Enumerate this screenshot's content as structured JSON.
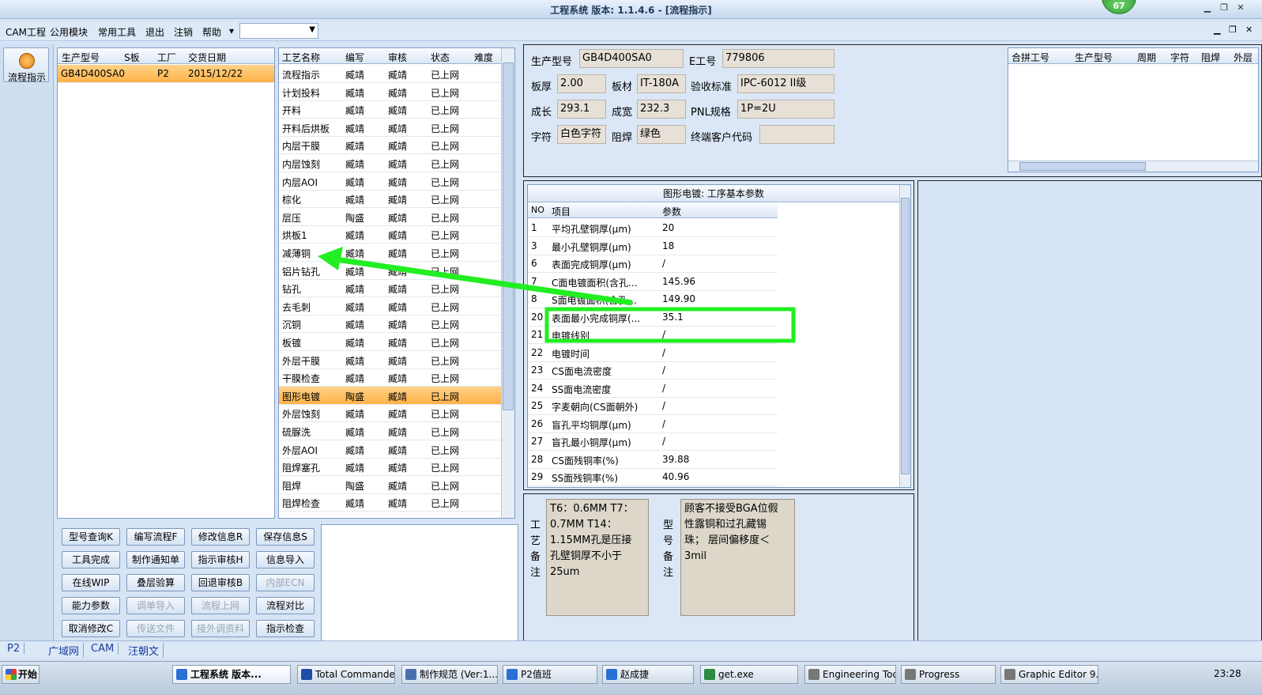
{
  "window": {
    "title": "工程系统  版本: 1.1.4.6 - [流程指示]",
    "badge": "67"
  },
  "menu": {
    "items": [
      "CAM工程",
      "公用模块",
      "常用工具",
      "退出",
      "注销",
      "帮助"
    ],
    "dropdown_arrow": "▾",
    "combo_value": ""
  },
  "leftstrip": {
    "flow_button": "流程指示"
  },
  "model_grid": {
    "headers": [
      "生产型号",
      "S板",
      "工厂",
      "交货日期"
    ],
    "rows": [
      [
        "GB4D400SA0",
        "",
        "P2",
        "2015/12/22"
      ]
    ]
  },
  "process_grid": {
    "headers": [
      "工艺名称",
      "编写",
      "审核",
      "状态",
      "难度"
    ],
    "rows": [
      [
        "流程指示",
        "臧靖",
        "臧靖",
        "已上网"
      ],
      [
        "计划投料",
        "臧靖",
        "臧靖",
        "已上网"
      ],
      [
        "开料",
        "臧靖",
        "臧靖",
        "已上网"
      ],
      [
        "开料后烘板",
        "臧靖",
        "臧靖",
        "已上网"
      ],
      [
        "内层干膜",
        "臧靖",
        "臧靖",
        "已上网"
      ],
      [
        "内层蚀刻",
        "臧靖",
        "臧靖",
        "已上网"
      ],
      [
        "内层AOI",
        "臧靖",
        "臧靖",
        "已上网"
      ],
      [
        "棕化",
        "臧靖",
        "臧靖",
        "已上网"
      ],
      [
        "层压",
        "陶盛",
        "臧靖",
        "已上网"
      ],
      [
        "烘板1",
        "臧靖",
        "臧靖",
        "已上网"
      ],
      [
        "减薄铜",
        "臧靖",
        "臧靖",
        "已上网"
      ],
      [
        "铝片钻孔",
        "臧靖",
        "臧靖",
        "已上网"
      ],
      [
        "钻孔",
        "臧靖",
        "臧靖",
        "已上网"
      ],
      [
        "去毛刺",
        "臧靖",
        "臧靖",
        "已上网"
      ],
      [
        "沉铜",
        "臧靖",
        "臧靖",
        "已上网"
      ],
      [
        "板镀",
        "臧靖",
        "臧靖",
        "已上网"
      ],
      [
        "外层干膜",
        "臧靖",
        "臧靖",
        "已上网"
      ],
      [
        "干膜检查",
        "臧靖",
        "臧靖",
        "已上网"
      ],
      [
        "图形电镀",
        "陶盛",
        "臧靖",
        "已上网"
      ],
      [
        "外层蚀刻",
        "臧靖",
        "臧靖",
        "已上网"
      ],
      [
        "硫脲洗",
        "臧靖",
        "臧靖",
        "已上网"
      ],
      [
        "外层AOI",
        "臧靖",
        "臧靖",
        "已上网"
      ],
      [
        "阻焊塞孔",
        "臧靖",
        "臧靖",
        "已上网"
      ],
      [
        "阻焊",
        "陶盛",
        "臧靖",
        "已上网"
      ],
      [
        "阻焊检查",
        "臧靖",
        "臧靖",
        "已上网"
      ]
    ],
    "selected_index": 18
  },
  "buttons": [
    {
      "label": "型号查询K",
      "enabled": true
    },
    {
      "label": "编写流程F",
      "enabled": true
    },
    {
      "label": "修改信息R",
      "enabled": true
    },
    {
      "label": "保存信息S",
      "enabled": true
    },
    {
      "label": "工具完成",
      "enabled": true
    },
    {
      "label": "制作通知单",
      "enabled": true
    },
    {
      "label": "指示审核H",
      "enabled": true
    },
    {
      "label": "信息导入",
      "enabled": true
    },
    {
      "label": "在线WIP",
      "enabled": true
    },
    {
      "label": "叠层验算",
      "enabled": true
    },
    {
      "label": "回退审核B",
      "enabled": true
    },
    {
      "label": "内部ECN",
      "enabled": false
    },
    {
      "label": "能力参数",
      "enabled": true
    },
    {
      "label": "调单导入",
      "enabled": false
    },
    {
      "label": "流程上网",
      "enabled": false
    },
    {
      "label": "流程对比",
      "enabled": true
    },
    {
      "label": "取消修改C",
      "enabled": true
    },
    {
      "label": "传送文件",
      "enabled": false
    },
    {
      "label": "接外调资料",
      "enabled": false
    },
    {
      "label": "指示检查",
      "enabled": true
    }
  ],
  "info": {
    "model_label": "生产型号",
    "model": "GB4D400SA0",
    "e_label": "E工号",
    "e_no": "779806",
    "thickness_label": "板厚",
    "thickness": "2.00",
    "material_label": "板材",
    "material": "IT-180A",
    "standard_label": "验收标准",
    "standard": "IPC-6012 II级",
    "length_label": "成长",
    "length": "293.1",
    "width_label": "成宽",
    "width": "232.3",
    "pnl_label": "PNL规格",
    "pnl": "1P=2U",
    "char_label": "字符",
    "char": "白色字符",
    "mask_label": "阻焊",
    "mask": "绿色",
    "customer_label": "终端客户代码",
    "customer": ""
  },
  "panel_grid": {
    "headers": [
      "合拼工号",
      "生产型号",
      "周期",
      "字符",
      "阻焊",
      "外层"
    ]
  },
  "params": {
    "title": "图形电镀: 工序基本参数",
    "headers": [
      "NO",
      "项目",
      "参数"
    ],
    "rows": [
      [
        "1",
        "平均孔壁铜厚(μm)",
        "20"
      ],
      [
        "3",
        "最小孔壁铜厚(μm)",
        "18"
      ],
      [
        "6",
        "表面完成铜厚(μm)",
        "/"
      ],
      [
        "7",
        "C面电镀面积(含孔...",
        "145.96"
      ],
      [
        "8",
        "S面电镀面积(含孔...",
        "149.90"
      ],
      [
        "20",
        "表面最小完成铜厚(...",
        "35.1"
      ],
      [
        "21",
        "电镀线别",
        "/"
      ],
      [
        "22",
        "电镀时间",
        "/"
      ],
      [
        "23",
        "CS面电流密度",
        "/"
      ],
      [
        "24",
        "SS面电流密度",
        "/"
      ],
      [
        "25",
        "字麦朝向(CS面朝外)",
        "/"
      ],
      [
        "26",
        "盲孔平均铜厚(μm)",
        "/"
      ],
      [
        "27",
        "盲孔最小铜厚(μm)",
        "/"
      ],
      [
        "28",
        "CS面残铜率(%)",
        "39.88"
      ],
      [
        "29",
        "SS面残铜率(%)",
        "40.96"
      ]
    ]
  },
  "remarks": {
    "process_label": [
      "工",
      "艺",
      "备",
      "注"
    ],
    "process_text": "T6：0.6MM T7：0.7MM T14：1.15MM孔是压接孔壁铜厚不小于25um",
    "model_label": [
      "型",
      "号",
      "备",
      "注"
    ],
    "model_text": "顾客不接受BGA位假性露铜和过孔藏锡珠；  层间偏移度＜3mil"
  },
  "status": {
    "items": [
      "P2",
      "广域网",
      "CAM",
      "汪朝文"
    ]
  },
  "taskbar": {
    "start": "开始",
    "tasks": [
      "工程系统  版本...",
      "Total Commander...",
      "制作规范 (Ver:1....",
      "P2值班",
      "赵成捷",
      "get.exe",
      "Engineering Toolk...",
      "Progress",
      "Graphic Editor 9...."
    ],
    "clock": "23:28"
  },
  "colors": {
    "accent": "#ffb347",
    "annotation": "#22ee22",
    "chrome": "#d6e4f5"
  }
}
